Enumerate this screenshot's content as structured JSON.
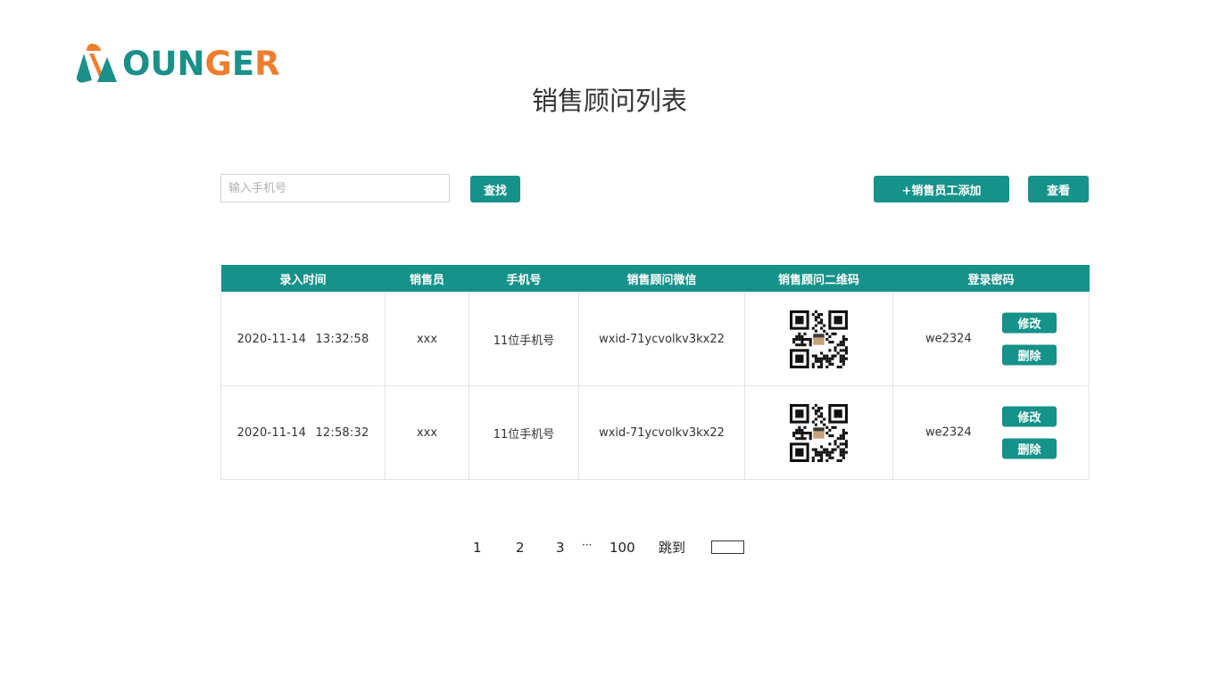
{
  "logo": {
    "text_teal": "OUN",
    "text_orange_g": "G",
    "text_teal_e": "E",
    "text_orange_r": "R"
  },
  "page_title": "销售顾问列表",
  "search": {
    "placeholder": "输入手机号",
    "value": ""
  },
  "buttons": {
    "search": "查找",
    "add": "+销售员工添加",
    "view": "查看"
  },
  "table": {
    "headers": [
      "录入时间",
      "销售员",
      "手机号",
      "销售顾问微信",
      "销售顾问二维码",
      "登录密码"
    ],
    "rows": [
      {
        "time": "2020-11-14 13:32:58",
        "seller": "xxx",
        "phone": "11位手机号",
        "wechat": "wxid-71ycvolkv3kx22",
        "password": "we2324",
        "edit": "修改",
        "delete": "删除"
      },
      {
        "time": "2020-11-14 12:58:32",
        "seller": "xxx",
        "phone": "11位手机号",
        "wechat": "wxid-71ycvolkv3kx22",
        "password": "we2324",
        "edit": "修改",
        "delete": "删除"
      }
    ]
  },
  "pagination": {
    "pages": [
      "1",
      "2",
      "3"
    ],
    "ellipsis": "···",
    "last": "100",
    "jump_label": "跳到",
    "jump_value": ""
  },
  "colors": {
    "accent": "#15928a",
    "logo_teal": "#1a9089",
    "logo_orange": "#ee7d2c"
  }
}
